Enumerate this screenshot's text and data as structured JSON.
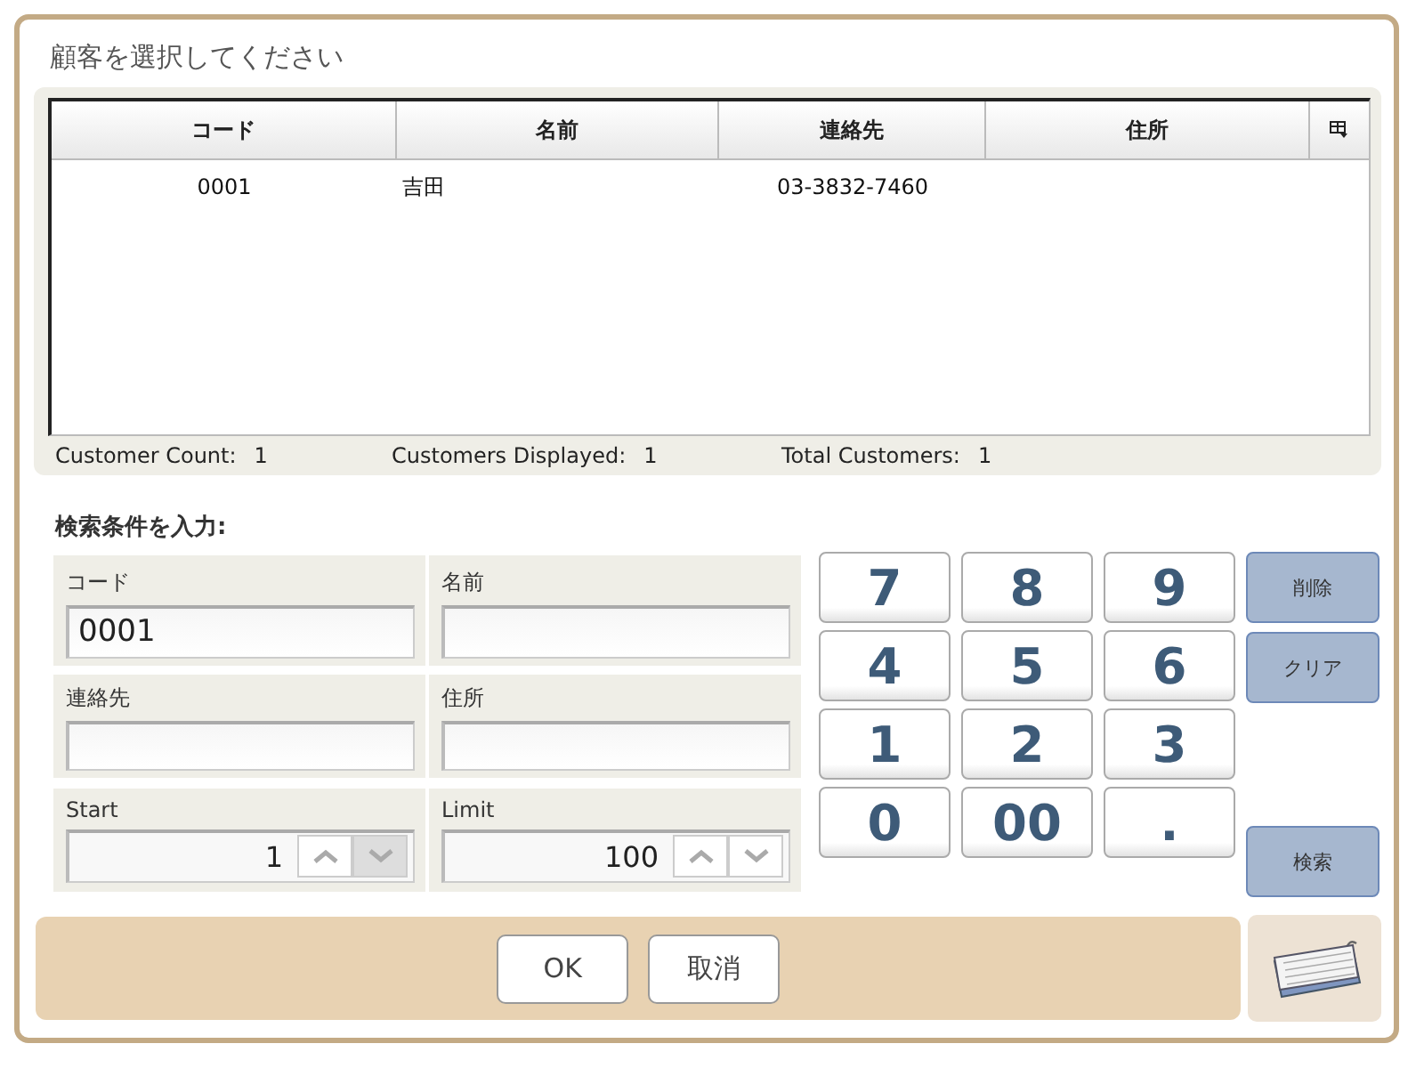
{
  "dialog": {
    "title": "顧客を選択してください"
  },
  "table": {
    "columns": [
      "コード",
      "名前",
      "連絡先",
      "住所"
    ],
    "rows": [
      {
        "cells": [
          "0001",
          "吉田",
          "03-3832-7460"
        ],
        "selected": false
      }
    ]
  },
  "counts": [
    {
      "label": "Customer Count:",
      "value": "1"
    },
    {
      "label": "Customers Displayed:",
      "value": "1"
    },
    {
      "label": "Total Customers:",
      "value": "1"
    }
  ],
  "search": {
    "heading": "検索条件を入力:",
    "fields": [
      {
        "kind": "text",
        "label": "コード",
        "value": "0001"
      },
      {
        "kind": "text",
        "label": "名前"
      },
      {
        "kind": "text",
        "label": "連絡先"
      },
      {
        "kind": "text",
        "label": "住所"
      },
      {
        "kind": "spinner",
        "label": "Start",
        "value": "1",
        "up_disabled": false,
        "down_disabled": true
      },
      {
        "kind": "spinner",
        "label": "Limit",
        "value": "100",
        "up_disabled": false,
        "down_disabled": false
      }
    ]
  },
  "keypad": {
    "keys": [
      "7",
      "8",
      "9",
      "4",
      "5",
      "6",
      "1",
      "2",
      "3",
      "0",
      "00",
      "."
    ],
    "actions": [
      {
        "label": "削除",
        "kind": "edit"
      },
      {
        "label": "クリア",
        "kind": "edit"
      },
      {
        "label": "検索",
        "kind": "submit"
      }
    ]
  },
  "buttons": [
    "OK",
    "取消"
  ]
}
